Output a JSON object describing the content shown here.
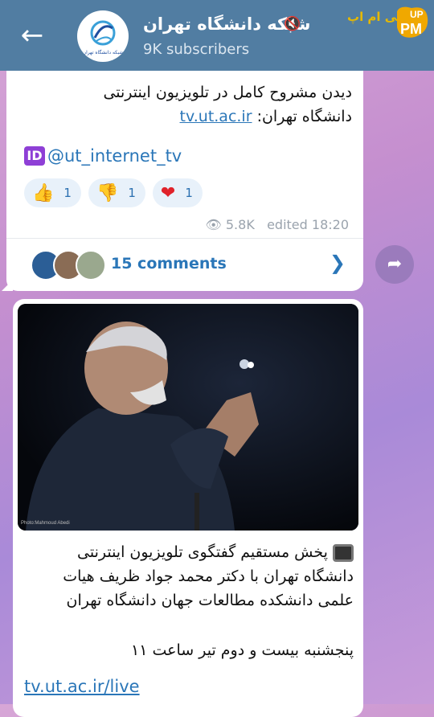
{
  "header": {
    "channel_name": "شبکه دانشگاه تهران",
    "subscribers": "9K subscribers",
    "avatar_caption": "شبکه دانشگاه تهران",
    "back_icon": "arrow-left-icon",
    "mute_icon": "speaker-muted-icon",
    "watermark_text": "پی ام اپ",
    "watermark_logo": "UP PM"
  },
  "post1": {
    "text_line": "دیدن مشروح کامل در تلویزیون اینترنتی",
    "text_prefix": "دانشگاه تهران:",
    "link": "tv.ut.ac.ir",
    "id_badge": "ID",
    "handle": "@ut_internet_tv",
    "reactions": [
      {
        "emoji": "👍",
        "count": "1"
      },
      {
        "emoji": "👎",
        "count": "1"
      },
      {
        "emoji": "❤",
        "count": "1"
      }
    ],
    "views": "5.8K",
    "edited": "edited 18:20",
    "comments_label": "15 comments"
  },
  "post2": {
    "lines": [
      "پخش مستقیم گفتگوی تلویزیون اینترنتی",
      "دانشگاه تهران با دکتر محمد جواد ظریف هیات",
      "علمی دانشکده مطالعات جهان دانشگاه تهران"
    ],
    "date_line": "پنجشنبه بیست و دوم تیر ساعت ۱۱",
    "link": "tv.ut.ac.ir/live",
    "photo_credit": "Photo:Mahmoud Abedi"
  },
  "colors": {
    "header_bg": "#517da2",
    "link": "#2a76b8",
    "reaction_bg": "#e8f1fa"
  }
}
